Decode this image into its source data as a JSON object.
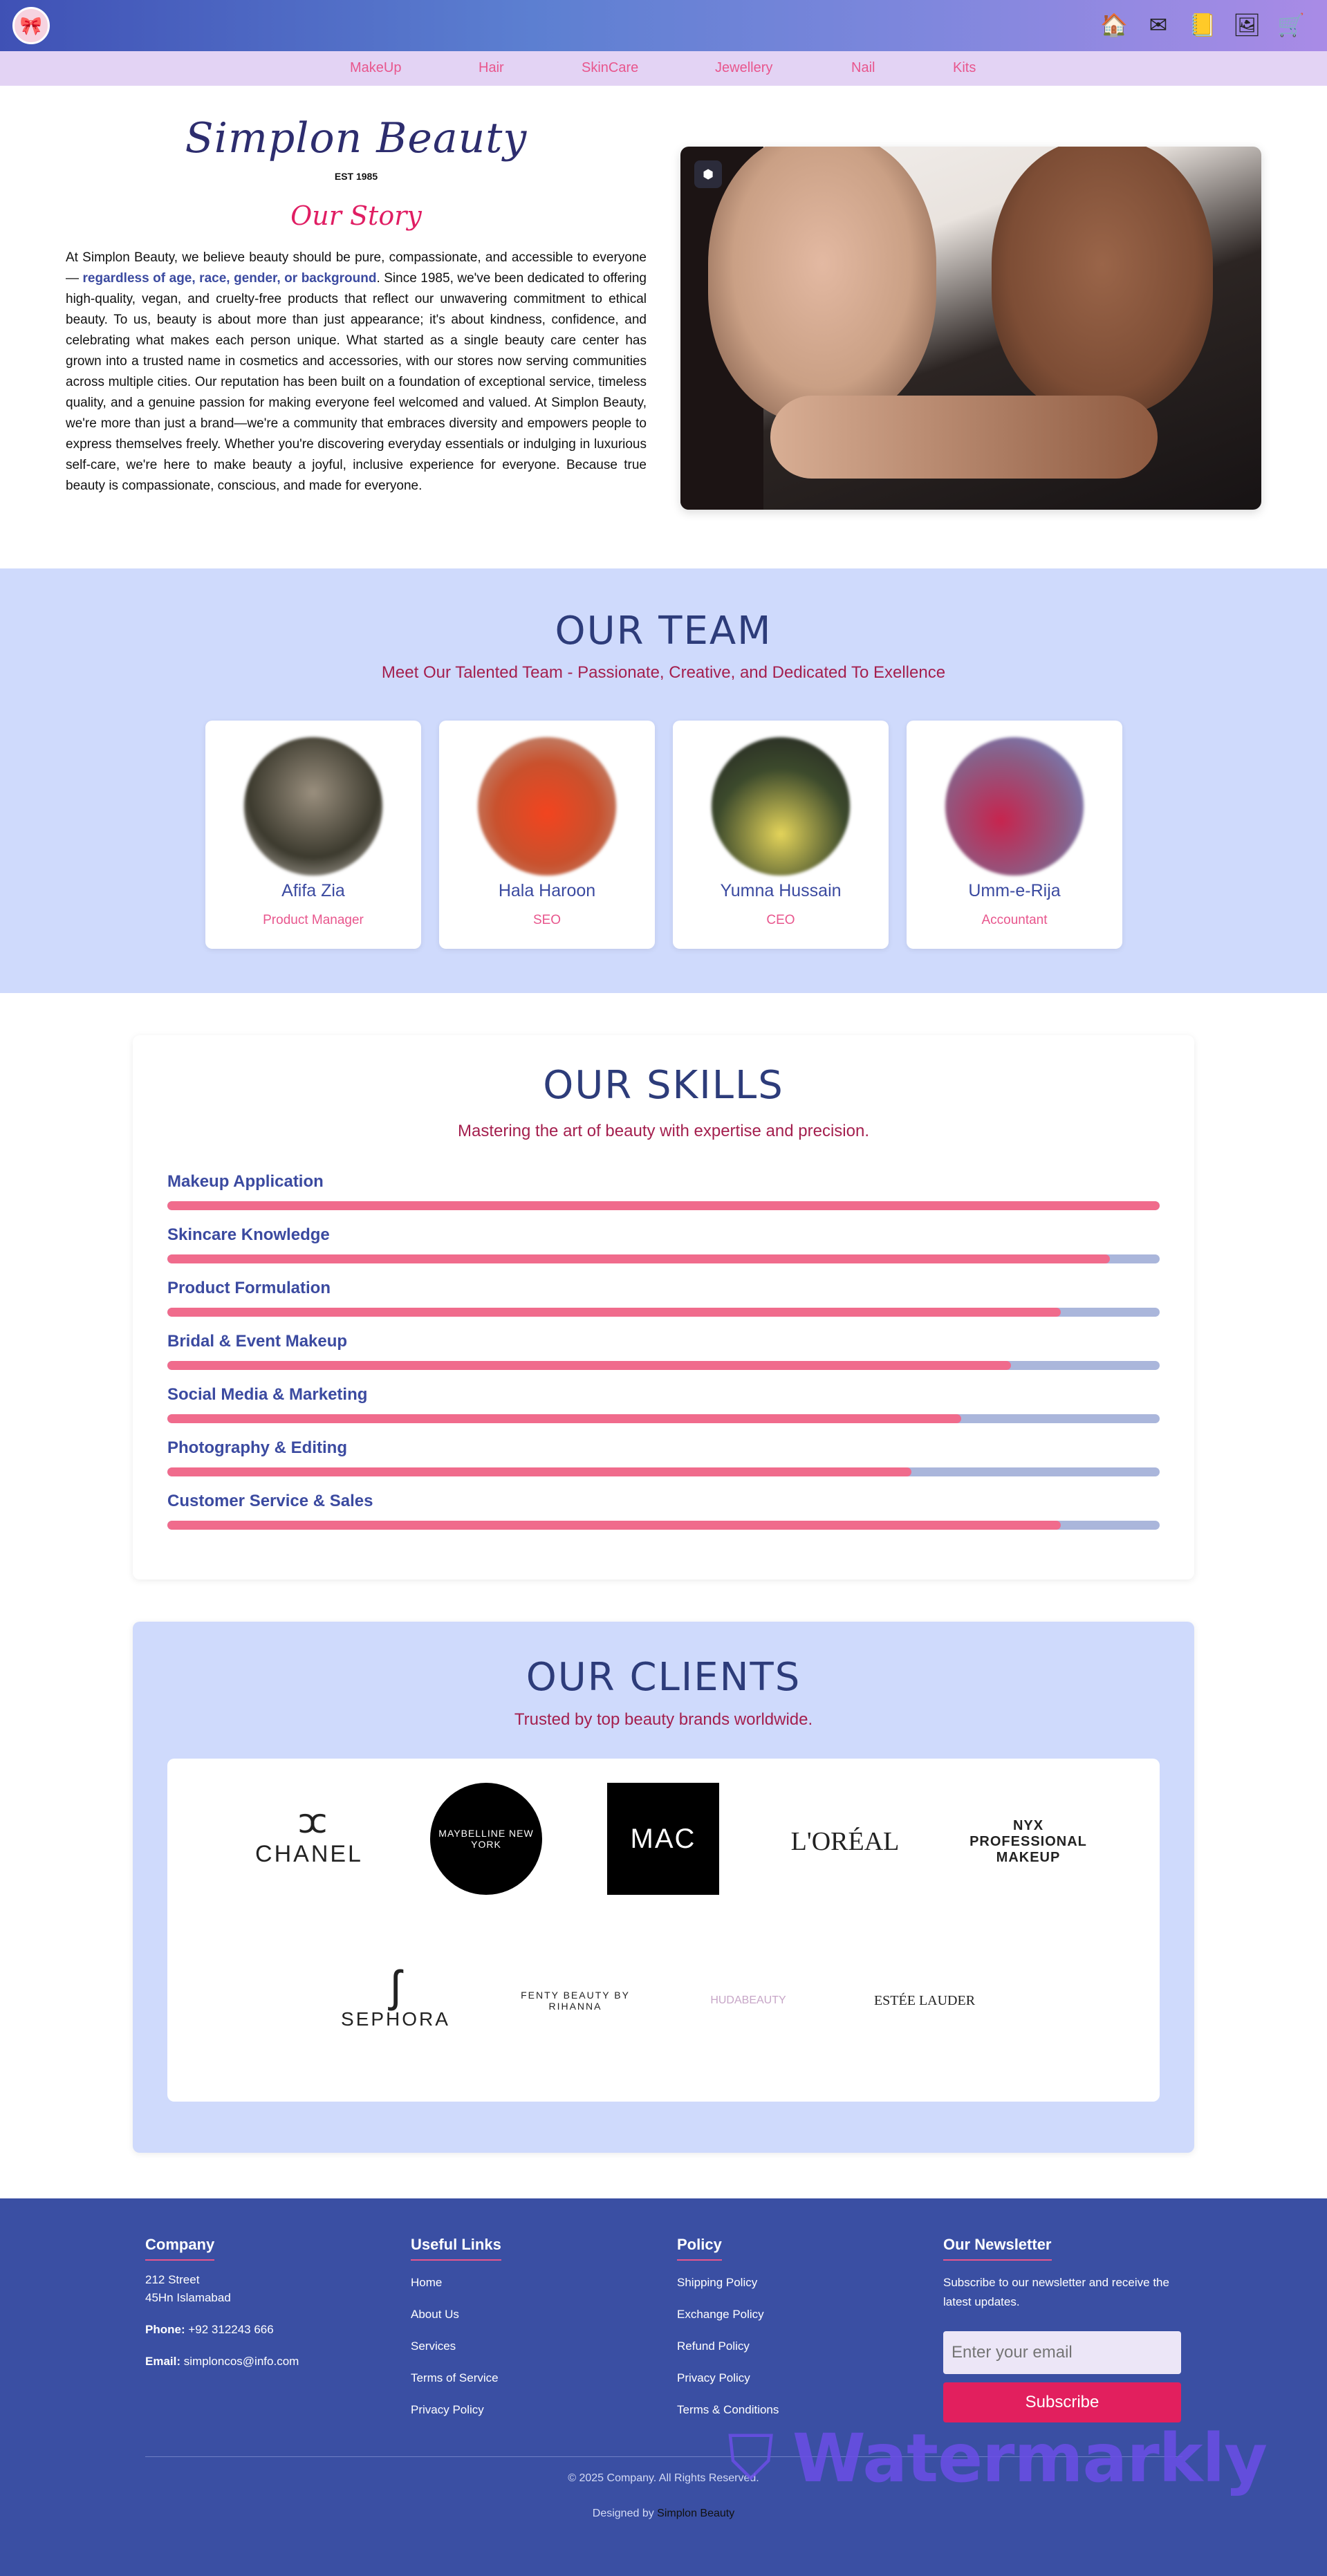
{
  "header": {
    "icons": [
      "home-icon",
      "mail-icon",
      "document-icon",
      "image-icon",
      "cart-icon"
    ],
    "nav": [
      "MakeUp",
      "Hair",
      "SkinCare",
      "Jewellery",
      "Nail",
      "Kits"
    ]
  },
  "story": {
    "brand": "Simplon Beauty",
    "est": "EST 1985",
    "title": "Our Story",
    "text_before": "At Simplon Beauty, we believe beauty should be pure, compassionate, and accessible to everyone— ",
    "text_highlight": "regardless of age, race, gender, or background",
    "text_after": ". Since 1985, we've been dedicated to offering high-quality, vegan, and cruelty-free products that reflect our unwavering commitment to ethical beauty. To us, beauty is about more than just appearance; it's about kindness, confidence, and celebrating what makes each person unique. What started as a single beauty care center has grown into a trusted name in cosmetics and accessories, with our stores now serving communities across multiple cities. Our reputation has been built on a foundation of exceptional service, timeless quality, and a genuine passion for making everyone feel welcomed and valued. At Simplon Beauty, we're more than just a brand—we're a community that embraces diversity and empowers people to express themselves freely. Whether you're discovering everyday essentials or indulging in luxurious self-care, we're here to make beauty a joyful, inclusive experience for everyone. Because true beauty is compassionate, conscious, and made for everyone."
  },
  "team": {
    "title": "OUR TEAM",
    "subtitle": "Meet Our Talented Team - Passionate, Creative, and Dedicated To Exellence",
    "members": [
      {
        "name": "Afifa Zia",
        "role": "Product Manager"
      },
      {
        "name": "Hala Haroon",
        "role": "SEO"
      },
      {
        "name": "Yumna Hussain",
        "role": "CEO"
      },
      {
        "name": "Umm-e-Rija",
        "role": "Accountant"
      }
    ]
  },
  "skills": {
    "title": "OUR SKILLS",
    "subtitle": "Mastering the art of beauty with expertise and precision.",
    "items": [
      {
        "label": "Makeup Application",
        "level": 1.0
      },
      {
        "label": "Skincare Knowledge",
        "level": 0.95
      },
      {
        "label": "Product Formulation",
        "level": 0.9
      },
      {
        "label": "Bridal & Event Makeup",
        "level": 0.85
      },
      {
        "label": "Social Media & Marketing",
        "level": 0.8
      },
      {
        "label": "Photography & Editing",
        "level": 0.75
      },
      {
        "label": "Customer Service & Sales",
        "level": 0.9
      }
    ]
  },
  "clients": {
    "title": "OUR CLIENTS",
    "subtitle": "Trusted by top beauty brands worldwide.",
    "logos": [
      "CHANEL",
      "MAYBELLINE NEW YORK",
      "MAC",
      "L'ORÉAL",
      "NYX PROFESSIONAL MAKEUP",
      "SEPHORA",
      "FENTY BEAUTY BY RIHANNA",
      "HUDABEAUTY",
      "ESTÉE LAUDER"
    ]
  },
  "footer": {
    "company": {
      "title": "Company",
      "street": "212 Street",
      "city": "45Hn Islamabad",
      "phone_label": "Phone:",
      "phone": "+92 312243 666",
      "email_label": "Email:",
      "email": "simploncos@info.com"
    },
    "links": {
      "title": "Useful Links",
      "items": [
        "Home",
        "About Us",
        "Services",
        "Terms of Service",
        "Privacy Policy"
      ]
    },
    "policy": {
      "title": "Policy",
      "items": [
        "Shipping Policy",
        "Exchange Policy",
        "Refund Policy",
        "Privacy Policy",
        "Terms & Conditions"
      ]
    },
    "newsletter": {
      "title": "Our Newsletter",
      "text": "Subscribe to our newsletter and receive the latest updates.",
      "placeholder": "Enter your email",
      "button": "Subscribe"
    },
    "copyright": "© 2025 Company. All Rights Reserved.",
    "designed_by": "Designed by",
    "designer": "Simplon Beauty",
    "watermark": "Watermarkly"
  }
}
